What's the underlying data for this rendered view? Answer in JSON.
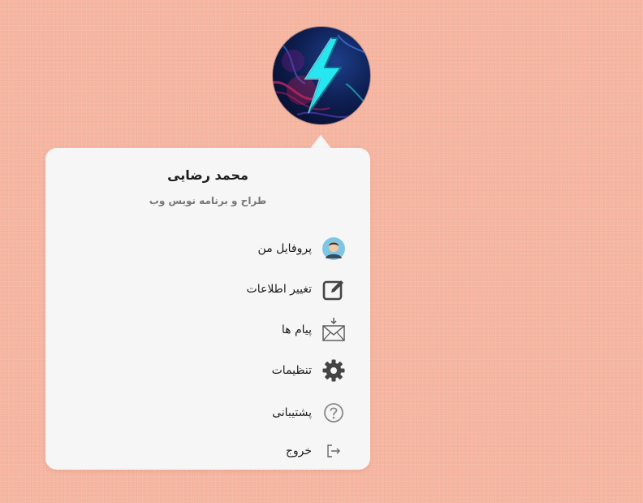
{
  "user": {
    "name": "محمد رضایی",
    "role": "طراح و برنامه نویس وب"
  },
  "menu": {
    "items": [
      {
        "label": "پروفایل من",
        "icon": "user-avatar-icon"
      },
      {
        "label": "تغییر اطلاعات",
        "icon": "edit-icon"
      },
      {
        "label": "پیام ها",
        "icon": "inbox-icon"
      },
      {
        "label": "تنظیمات",
        "icon": "gear-icon"
      },
      {
        "label": "پشتیبانی",
        "icon": "help-icon"
      },
      {
        "label": "خروج",
        "icon": "logout-icon"
      }
    ]
  },
  "colors": {
    "background": "#f5b5a0",
    "card": "#f6f6f6",
    "text": "#1c1c1c",
    "muted": "#777777",
    "bolt": "#26e6f2"
  }
}
